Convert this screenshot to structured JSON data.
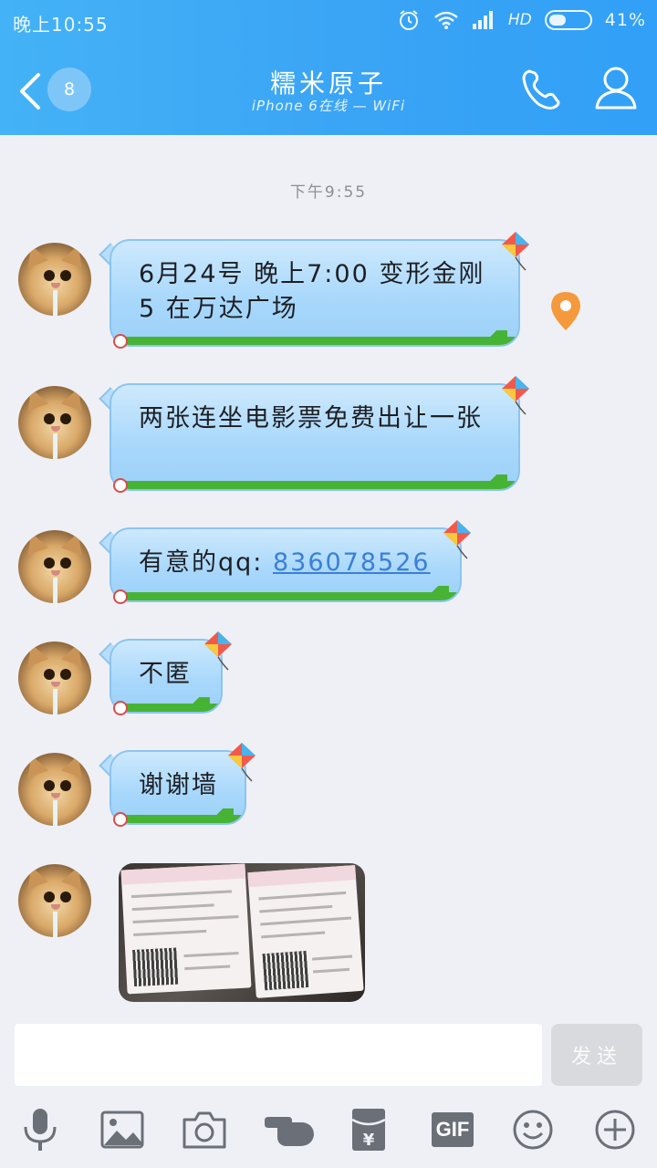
{
  "status_bar": {
    "time": "晚上10:55",
    "network": "HD",
    "battery": "41%",
    "battery_level": 0.41
  },
  "header": {
    "unread_count": "8",
    "contact_name": "糯米原子",
    "status_line": "iPhone 6在线 — WiFi"
  },
  "chat": {
    "timestamp": "下午9:55",
    "messages": [
      {
        "text": "6月24号 晚上7:00 变形金刚5 在万达广场"
      },
      {
        "text": "两张连坐电影票免费出让一张"
      },
      {
        "prefix": "有意的qq: ",
        "link": "836078526"
      },
      {
        "text": "不匿"
      },
      {
        "text": "谢谢墙"
      }
    ]
  },
  "composer": {
    "input_value": "",
    "send_label": "发送"
  },
  "toolbar": {
    "items": [
      "microphone-icon",
      "image-icon",
      "camera-icon",
      "poke-icon",
      "red-packet-icon",
      "gif-icon",
      "emoji-icon",
      "plus-icon"
    ],
    "gif_label": "GIF",
    "red_packet_symbol": "¥"
  },
  "colors": {
    "header_gradient_start": "#44b2f6",
    "header_gradient_end": "#31a0f6",
    "bubble": "#a7d7fb",
    "grass": "#47b334",
    "link": "#3b7fd8",
    "location_pin": "#f59a3c"
  }
}
